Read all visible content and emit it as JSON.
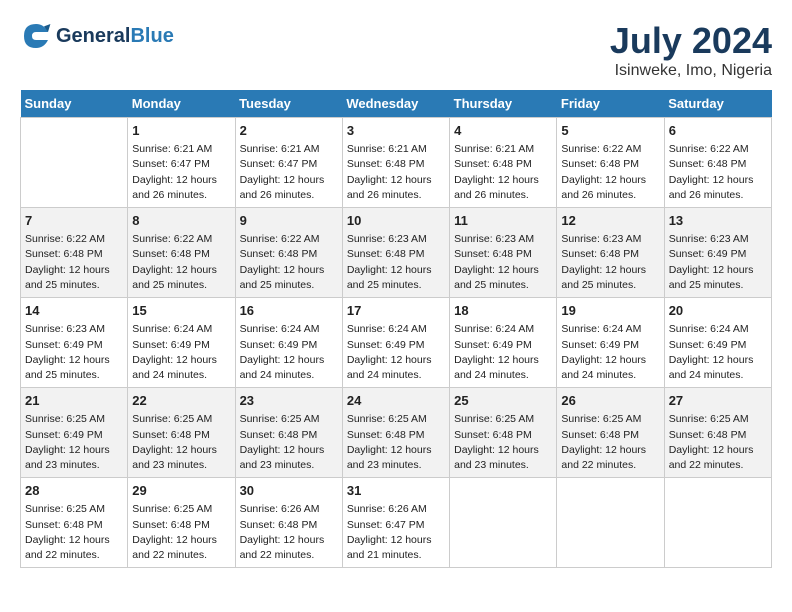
{
  "header": {
    "logo_line1": "General",
    "logo_line2": "Blue",
    "month": "July 2024",
    "location": "Isinweke, Imo, Nigeria"
  },
  "days_of_week": [
    "Sunday",
    "Monday",
    "Tuesday",
    "Wednesday",
    "Thursday",
    "Friday",
    "Saturday"
  ],
  "weeks": [
    [
      {
        "day": "",
        "info": ""
      },
      {
        "day": "1",
        "info": "Sunrise: 6:21 AM\nSunset: 6:47 PM\nDaylight: 12 hours\nand 26 minutes."
      },
      {
        "day": "2",
        "info": "Sunrise: 6:21 AM\nSunset: 6:47 PM\nDaylight: 12 hours\nand 26 minutes."
      },
      {
        "day": "3",
        "info": "Sunrise: 6:21 AM\nSunset: 6:48 PM\nDaylight: 12 hours\nand 26 minutes."
      },
      {
        "day": "4",
        "info": "Sunrise: 6:21 AM\nSunset: 6:48 PM\nDaylight: 12 hours\nand 26 minutes."
      },
      {
        "day": "5",
        "info": "Sunrise: 6:22 AM\nSunset: 6:48 PM\nDaylight: 12 hours\nand 26 minutes."
      },
      {
        "day": "6",
        "info": "Sunrise: 6:22 AM\nSunset: 6:48 PM\nDaylight: 12 hours\nand 26 minutes."
      }
    ],
    [
      {
        "day": "7",
        "info": ""
      },
      {
        "day": "8",
        "info": "Sunrise: 6:22 AM\nSunset: 6:48 PM\nDaylight: 12 hours\nand 25 minutes."
      },
      {
        "day": "9",
        "info": "Sunrise: 6:22 AM\nSunset: 6:48 PM\nDaylight: 12 hours\nand 25 minutes."
      },
      {
        "day": "10",
        "info": "Sunrise: 6:23 AM\nSunset: 6:48 PM\nDaylight: 12 hours\nand 25 minutes."
      },
      {
        "day": "11",
        "info": "Sunrise: 6:23 AM\nSunset: 6:48 PM\nDaylight: 12 hours\nand 25 minutes."
      },
      {
        "day": "12",
        "info": "Sunrise: 6:23 AM\nSunset: 6:48 PM\nDaylight: 12 hours\nand 25 minutes."
      },
      {
        "day": "13",
        "info": "Sunrise: 6:23 AM\nSunset: 6:49 PM\nDaylight: 12 hours\nand 25 minutes."
      }
    ],
    [
      {
        "day": "14",
        "info": ""
      },
      {
        "day": "15",
        "info": "Sunrise: 6:24 AM\nSunset: 6:49 PM\nDaylight: 12 hours\nand 24 minutes."
      },
      {
        "day": "16",
        "info": "Sunrise: 6:24 AM\nSunset: 6:49 PM\nDaylight: 12 hours\nand 24 minutes."
      },
      {
        "day": "17",
        "info": "Sunrise: 6:24 AM\nSunset: 6:49 PM\nDaylight: 12 hours\nand 24 minutes."
      },
      {
        "day": "18",
        "info": "Sunrise: 6:24 AM\nSunset: 6:49 PM\nDaylight: 12 hours\nand 24 minutes."
      },
      {
        "day": "19",
        "info": "Sunrise: 6:24 AM\nSunset: 6:49 PM\nDaylight: 12 hours\nand 24 minutes."
      },
      {
        "day": "20",
        "info": "Sunrise: 6:24 AM\nSunset: 6:49 PM\nDaylight: 12 hours\nand 24 minutes."
      }
    ],
    [
      {
        "day": "21",
        "info": ""
      },
      {
        "day": "22",
        "info": "Sunrise: 6:25 AM\nSunset: 6:48 PM\nDaylight: 12 hours\nand 23 minutes."
      },
      {
        "day": "23",
        "info": "Sunrise: 6:25 AM\nSunset: 6:48 PM\nDaylight: 12 hours\nand 23 minutes."
      },
      {
        "day": "24",
        "info": "Sunrise: 6:25 AM\nSunset: 6:48 PM\nDaylight: 12 hours\nand 23 minutes."
      },
      {
        "day": "25",
        "info": "Sunrise: 6:25 AM\nSunset: 6:48 PM\nDaylight: 12 hours\nand 23 minutes."
      },
      {
        "day": "26",
        "info": "Sunrise: 6:25 AM\nSunset: 6:48 PM\nDaylight: 12 hours\nand 22 minutes."
      },
      {
        "day": "27",
        "info": "Sunrise: 6:25 AM\nSunset: 6:48 PM\nDaylight: 12 hours\nand 22 minutes."
      }
    ],
    [
      {
        "day": "28",
        "info": "Sunrise: 6:25 AM\nSunset: 6:48 PM\nDaylight: 12 hours\nand 22 minutes."
      },
      {
        "day": "29",
        "info": "Sunrise: 6:25 AM\nSunset: 6:48 PM\nDaylight: 12 hours\nand 22 minutes."
      },
      {
        "day": "30",
        "info": "Sunrise: 6:26 AM\nSunset: 6:48 PM\nDaylight: 12 hours\nand 22 minutes."
      },
      {
        "day": "31",
        "info": "Sunrise: 6:26 AM\nSunset: 6:47 PM\nDaylight: 12 hours\nand 21 minutes."
      },
      {
        "day": "",
        "info": ""
      },
      {
        "day": "",
        "info": ""
      },
      {
        "day": "",
        "info": ""
      }
    ]
  ],
  "week1_day7_info": "Sunrise: 6:22 AM\nSunset: 6:48 PM\nDaylight: 12 hours\nand 25 minutes.",
  "week3_day14_info": "Sunrise: 6:23 AM\nSunset: 6:49 PM\nDaylight: 12 hours\nand 25 minutes.",
  "week4_day21_info": "Sunrise: 6:25 AM\nSunset: 6:49 PM\nDaylight: 12 hours\nand 23 minutes."
}
